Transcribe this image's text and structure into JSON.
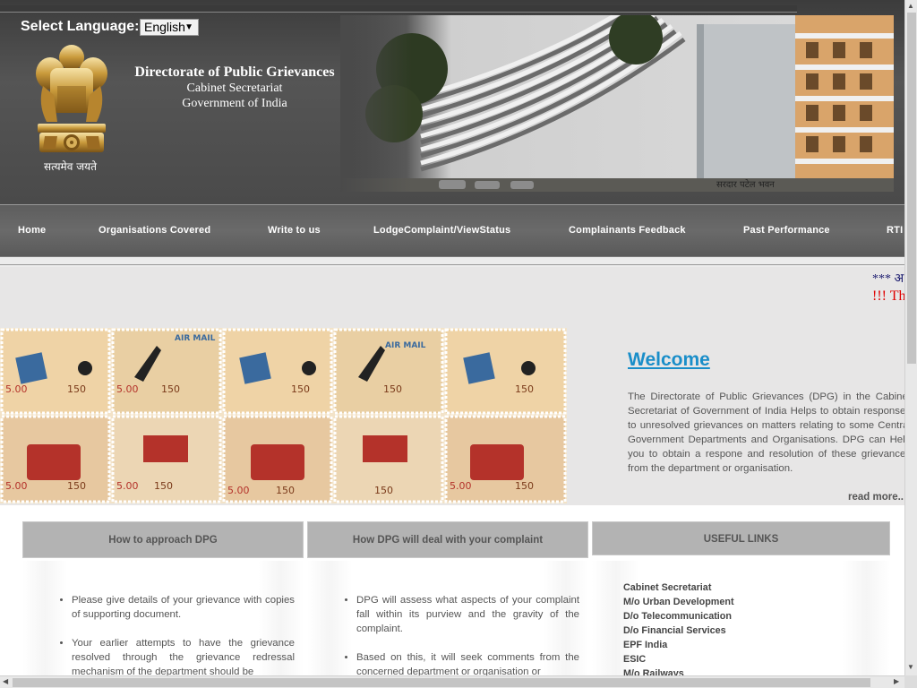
{
  "header": {
    "select_language_label": "Select Language:",
    "language_selected": "English",
    "emblem_motto": "सत्यमेव जयते",
    "dept_line1": "Directorate of Public Grievances",
    "dept_line2": "Cabinet Secretariat",
    "dept_line3": "Government of India",
    "building_sign": "सरदार पटेल भवन"
  },
  "nav": {
    "items": [
      "Home",
      "Organisations Covered",
      "Write to us",
      "LodgeComplaint/ViewStatus",
      "Complainants Feedback",
      "Past Performance",
      "RTI"
    ]
  },
  "marquee": {
    "line1": "*** अ",
    "line2": "!!! Th"
  },
  "welcome": {
    "title": "Welcome",
    "text": "The Directorate of Public Grievances (DPG) in the Cabinet Secretariat of Government of India Helps to obtain responses to unresolved grievances on matters relating to some Central Government Departments and Organisations. DPG can Help you to obtain a respone and resolution of these grievances from the department or organisation.",
    "read_more": "read more.."
  },
  "panels": {
    "approach": {
      "title": "How to approach DPG",
      "items": [
        "Please give details of your grievance with copies of supporting document.",
        "Your earlier attempts to have the grievance resolved through the grievance redressal mechanism of the department should be"
      ]
    },
    "deal": {
      "title": "How DPG will deal with your complaint",
      "items": [
        "DPG will assess what aspects of your complaint fall within its purview and the gravity of the complaint.",
        "Based on this, it will seek comments from the concerned department or organisation or"
      ]
    },
    "useful": {
      "title": "USEFUL LINKS",
      "links": [
        "Cabinet Secretariat",
        "M/o Urban Development",
        "D/o Telecommunication",
        "D/o Financial Services",
        "EPF India",
        "ESIC",
        "M/o Railways"
      ]
    }
  },
  "colors": {
    "welcome_link": "#1a8ec9",
    "nav_bg": "#606060",
    "marquee_red": "#e00000",
    "marquee_blue": "#1a1a6e"
  }
}
